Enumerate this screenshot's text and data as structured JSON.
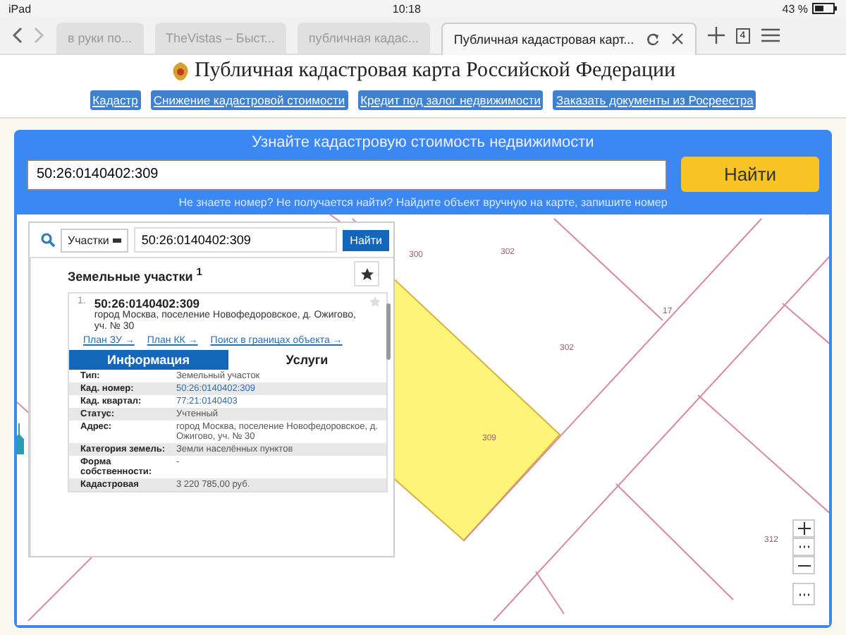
{
  "status_bar": {
    "device": "iPad",
    "time": "10:18",
    "battery": "43 %"
  },
  "browser_tabs": [
    {
      "title": "в руки по...",
      "selected": false
    },
    {
      "title": "TheVistas – Быст...",
      "selected": false
    },
    {
      "title": "публичная кадас...",
      "selected": false
    },
    {
      "title": "Публичная кадастровая карт...",
      "selected": true
    }
  ],
  "tab_count": "4",
  "site_title": "Публичная кадастровая карта Российской Федерации",
  "nav_links": [
    "Кадастр",
    "Снижение кадастровой стоимости",
    "Кредит под залог недвижимости",
    "Заказать документы из Росреестра"
  ],
  "search_panel": {
    "title": "Узнайте кадастровую стоимость недвижимости",
    "value": "50:26:0140402:309",
    "button": "Найти",
    "hint": "Не знаете номер? Не получается найти? Найдите объект вручную на карте, запишите номер"
  },
  "map": {
    "parcel_labels": [
      "300",
      "302",
      "302",
      "17",
      "309",
      "312"
    ],
    "results_panel": {
      "type_select": "Участки",
      "query": "50:26:0140402:309",
      "search_button": "Найти",
      "heading": "Земельные участки $^{1}$",
      "result": {
        "index": "1.",
        "number": "50:26:0140402:309",
        "address": "город Москва, поселение Новофедоровское, д. Ожигово, уч. № 30",
        "links": [
          "План ЗУ →",
          "План КК →",
          "Поиск в границах объекта →"
        ]
      },
      "tabs": [
        {
          "label": "Информация",
          "selected": true
        },
        {
          "label": "Услуги",
          "selected": false
        }
      ],
      "rows": [
        {
          "label": "Тип:",
          "value": "Земельный участок",
          "kind": "text"
        },
        {
          "label": "Кад. номер:",
          "value": "50:26:0140402:309",
          "kind": "link"
        },
        {
          "label": "Кад. квартал:",
          "value": "77:21:0140403",
          "kind": "link"
        },
        {
          "label": "Статус:",
          "value": "Учтенный",
          "kind": "text"
        },
        {
          "label": "Адрес:",
          "value": "город Москва, поселение Новофедоровское, д. Ожигово, уч. № 30",
          "kind": "text"
        },
        {
          "label": "Категория земель:",
          "value": "Земли населённых пунктов",
          "kind": "text"
        },
        {
          "label": "Форма собственности:",
          "value": "-",
          "kind": "text"
        },
        {
          "label": "Кадастровая",
          "value": "3 220 785,00 руб.",
          "kind": "text"
        }
      ]
    }
  }
}
